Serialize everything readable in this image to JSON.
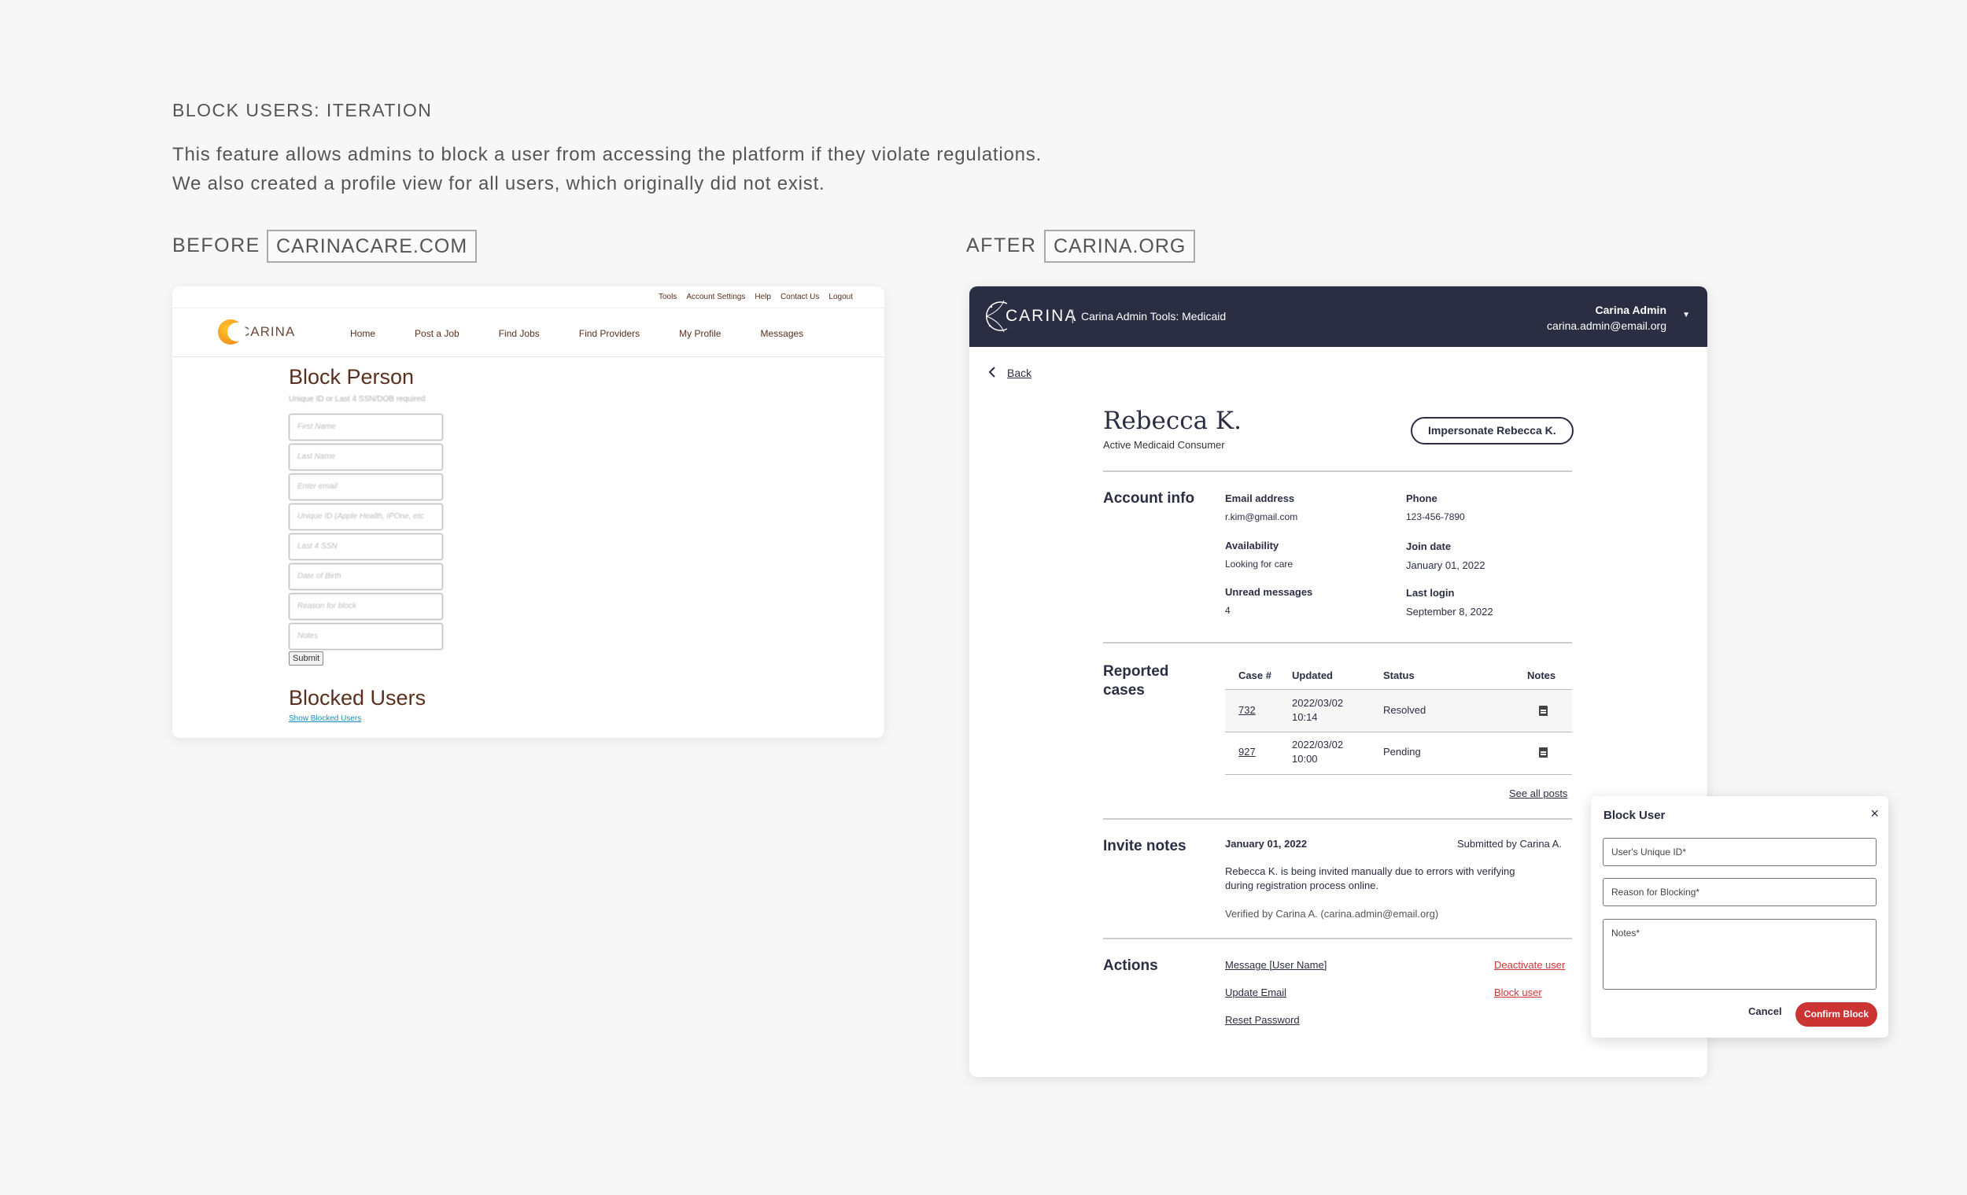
{
  "section_title": "BLOCK USERS: ITERATION",
  "description": {
    "line1": "This feature allows admins to block a user from accessing the platform if they violate regulations.",
    "line2": "We also created a profile view for all users, which originally did not exist."
  },
  "before": {
    "label": "BEFORE",
    "site": "CARINACARE.COM",
    "top_links": [
      "Tools",
      "Account Settings",
      "Help",
      "Contact Us",
      "Logout"
    ],
    "logo_text": "CARINA",
    "nav": [
      "Home",
      "Post a Job",
      "Find Jobs",
      "Find Providers",
      "My Profile",
      "Messages"
    ],
    "heading": "Block Person",
    "subheading": "Unique ID or Last 4 SSN/DOB required",
    "fields": [
      "First Name",
      "Last Name",
      "Enter email",
      "Unique ID (Apple Health, IPOne, etc",
      "Last 4 SSN",
      "Date of Birth",
      "Reason for block",
      "Notes"
    ],
    "submit": "Submit",
    "heading2": "Blocked Users",
    "show_link": "Show Blocked Users"
  },
  "after": {
    "label": "AFTER",
    "site": "CARINA.ORG",
    "header": {
      "brand": "CARINA",
      "separator": "|",
      "tool": "Carina Admin Tools: Medicaid",
      "user_name": "Carina Admin",
      "user_email": "carina.admin@email.org"
    },
    "back": "Back",
    "profile": {
      "name": "Rebecca K.",
      "role": "Active Medicaid Consumer",
      "impersonate": "Impersonate Rebecca K."
    },
    "account_info": {
      "title": "Account info",
      "email_label": "Email address",
      "email": "r.kim@gmail.com",
      "phone_label": "Phone",
      "phone": "123-456-7890",
      "availability_label": "Availability",
      "availability": "Looking for care",
      "join_label": "Join date",
      "join": "January 01, 2022",
      "unread_label": "Unread messages",
      "unread": "4",
      "login_label": "Last login",
      "login": "September 8, 2022"
    },
    "reported": {
      "title_line1": "Reported",
      "title_line2": "cases",
      "headers": [
        "Case #",
        "Updated",
        "Status",
        "Notes"
      ],
      "rows": [
        {
          "case": "732",
          "updated_date": "2022/03/02",
          "updated_time": "10:14",
          "status": "Resolved"
        },
        {
          "case": "927",
          "updated_date": "2022/03/02",
          "updated_time": "10:00",
          "status": "Pending"
        }
      ],
      "see_all": "See all posts"
    },
    "invite": {
      "title": "Invite notes",
      "date": "January 01, 2022",
      "submitted": "Submitted by Carina A.",
      "text_line1": "Rebecca K. is being invited manually due to errors with verifying",
      "text_line2": "during registration process online.",
      "verified": "Verified by Carina A. (carina.admin@email.org)"
    },
    "actions": {
      "title": "Actions",
      "message": "Message [User Name]",
      "update_email": "Update Email",
      "reset_password": "Reset Password",
      "deactivate": "Deactivate user",
      "block": "Block user"
    }
  },
  "modal": {
    "title": "Block User",
    "close": "×",
    "unique_id": "User's Unique ID*",
    "reason": "Reason for Blocking*",
    "notes": "Notes*",
    "cancel": "Cancel",
    "confirm": "Confirm Block"
  },
  "colors": {
    "header_bg": "#2b2e43",
    "danger": "#cc3434",
    "before_brown": "#5a2f1e",
    "link_blue": "#1a8fbf"
  }
}
